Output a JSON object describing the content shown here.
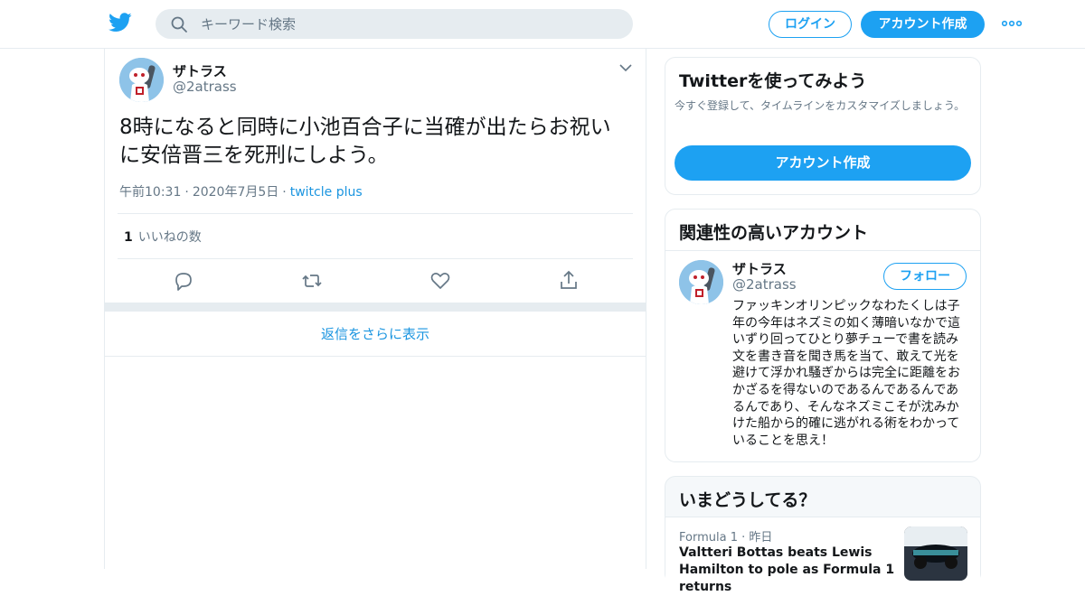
{
  "header": {
    "search_placeholder": "キーワード検索",
    "login_label": "ログイン",
    "signup_label": "アカウント作成",
    "brand_color": "#1da1f2"
  },
  "tweet": {
    "name": "ザトラス",
    "handle": "@2atrass",
    "text": "8時になると同時に小池百合子に当確が出たらお祝いに安倍晋三を死刑にしよう。",
    "time": "午前10:31",
    "date": "2020年7月5日",
    "source": "twitcle plus",
    "likes_count": "1",
    "likes_label": "いいねの数",
    "more_replies": "返信をさらに表示"
  },
  "sidebar": {
    "signup_card": {
      "title": "Twitterを使ってみよう",
      "subtitle": "今すぐ登録して、タイムラインをカスタマイズしましょう。",
      "button": "アカウント作成"
    },
    "related": {
      "title": "関連性の高いアカウント",
      "account": {
        "name": "ザトラス",
        "handle": "@2atrass",
        "follow_label": "フォロー",
        "bio": "ファッキンオリンピックなわたくしは子年の今年はネズミの如く薄暗いなかで這いずり回ってひとり夢チューで書を読み文を書き音を聞き馬を当て、敢えて光を避けて浮かれ騒ぎからは完全に距離をおかざるを得ないのであるんであるんであるんであり、そんなネズミこそが沈みかけた船から的確に逃がれる術をわかっていることを思え！"
      }
    },
    "trends": {
      "title": "いまどうしてる？",
      "item": {
        "category": "Formula 1",
        "when": "昨日",
        "headline": "Valtteri Bottas beats Lewis Hamilton to pole as Formula 1 returns"
      }
    }
  }
}
